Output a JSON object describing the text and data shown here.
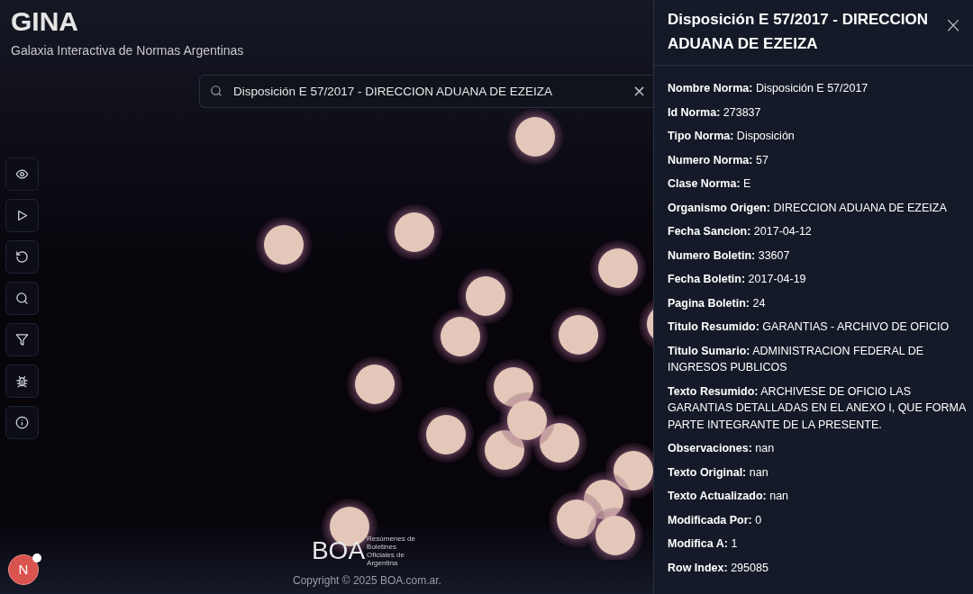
{
  "app": {
    "title": "GINA",
    "subtitle": "Galaxia Interactiva de Normas Argentinas"
  },
  "search": {
    "value": "Disposición E 57/2017 - DIRECCION ADUANA DE EZEIZA",
    "clear": "×"
  },
  "toolbar": [
    {
      "kind": "eye"
    },
    {
      "kind": "play"
    },
    {
      "kind": "reset"
    },
    {
      "kind": "search"
    },
    {
      "kind": "filter"
    },
    {
      "kind": "bug"
    },
    {
      "kind": "info"
    }
  ],
  "footer": {
    "logo": "BOA",
    "logo_tagline": "Resúmenes de Boletines Oficiales de Argentina",
    "copyright": "Copyright © 2025 BOA.com.ar."
  },
  "avatar": {
    "letter": "N",
    "notification": true
  },
  "panel": {
    "title": "Disposición E 57/2017 - DIRECCION ADUANA DE EZEIZA",
    "close": "×",
    "fields": [
      {
        "label": "Nombre Norma:",
        "value": "Disposición E 57/2017"
      },
      {
        "label": "Id Norma:",
        "value": "273837"
      },
      {
        "label": "Tipo Norma:",
        "value": "Disposición"
      },
      {
        "label": "Numero Norma:",
        "value": "57"
      },
      {
        "label": "Clase Norma:",
        "value": "E"
      },
      {
        "label": "Organismo Origen:",
        "value": "DIRECCION ADUANA DE EZEIZA"
      },
      {
        "label": "Fecha Sancion:",
        "value": "2017-04-12"
      },
      {
        "label": "Numero Boletin:",
        "value": "33607"
      },
      {
        "label": "Fecha Boletin:",
        "value": "2017-04-19"
      },
      {
        "label": "Pagina Boletin:",
        "value": "24"
      },
      {
        "label": "Titulo Resumido:",
        "value": "GARANTIAS - ARCHIVO DE OFICIO"
      },
      {
        "label": "Titulo Sumario:",
        "value": "ADMINISTRACION FEDERAL DE INGRESOS PUBLICOS"
      },
      {
        "label": "Texto Resumido:",
        "value": "ARCHIVESE DE OFICIO LAS GARANTIAS DETALLADAS EN EL ANEXO I, QUE FORMA PARTE INTEGRANTE DE LA PRESENTE."
      },
      {
        "label": "Observaciones:",
        "value": "nan"
      },
      {
        "label": "Texto Original:",
        "value": "nan"
      },
      {
        "label": "Texto Actualizado:",
        "value": "nan"
      },
      {
        "label": "Modificada Por:",
        "value": "0"
      },
      {
        "label": "Modifica A:",
        "value": "1"
      },
      {
        "label": "Row Index:",
        "value": "295085"
      }
    ]
  }
}
